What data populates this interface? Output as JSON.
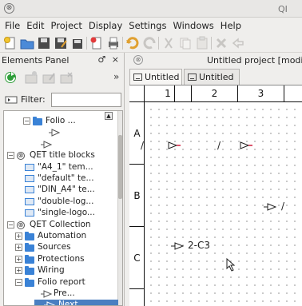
{
  "window": {
    "title": "QI"
  },
  "menu": [
    "File",
    "Edit",
    "Project",
    "Display",
    "Settings",
    "Windows",
    "Help"
  ],
  "elements_panel": {
    "title": "Elements Panel",
    "title_buttons": "♂ ×",
    "filter_label": "Filter:",
    "filter_value": "",
    "tree": [
      {
        "label": "Folio ...",
        "indent": 2,
        "type": "folder",
        "expander": "−"
      },
      {
        "label": "",
        "indent": 4,
        "type": "symbol"
      },
      {
        "label": "",
        "indent": 3,
        "type": "symbol"
      },
      {
        "label": "QET title blocks",
        "indent": 0,
        "type": "qet",
        "expander": "−"
      },
      {
        "label": "\"A4_1\" tem...",
        "indent": 1,
        "type": "tblock"
      },
      {
        "label": "\"default\" te...",
        "indent": 1,
        "type": "tblock"
      },
      {
        "label": "\"DIN_A4\" te...",
        "indent": 1,
        "type": "tblock"
      },
      {
        "label": "\"double-log...",
        "indent": 1,
        "type": "tblock"
      },
      {
        "label": "\"single-logo...",
        "indent": 1,
        "type": "tblock"
      },
      {
        "label": "QET Collection",
        "indent": 0,
        "type": "qet",
        "expander": "−"
      },
      {
        "label": "Automation",
        "indent": 1,
        "type": "folder",
        "expander": "+"
      },
      {
        "label": "Sources",
        "indent": 1,
        "type": "folder",
        "expander": "+"
      },
      {
        "label": "Protections",
        "indent": 1,
        "type": "folder",
        "expander": "+"
      },
      {
        "label": "Wiring",
        "indent": 1,
        "type": "folder",
        "expander": "+"
      },
      {
        "label": "Folio report",
        "indent": 1,
        "type": "folder",
        "expander": "−"
      },
      {
        "label": "Pre...",
        "indent": 3,
        "type": "symbol"
      },
      {
        "label": "Next...",
        "indent": 3,
        "type": "symbol",
        "selected": true
      }
    ]
  },
  "main": {
    "title": "Untitled project [modifi",
    "tabs": [
      "Untitled",
      "Untitled"
    ],
    "columns": [
      "1",
      "2",
      "3"
    ],
    "rows": [
      "A",
      "B",
      "C"
    ],
    "canvas_labels": {
      "slash_a1": "/",
      "slash_a2": "/",
      "slash_b": "/",
      "ref_c": "2-C3"
    }
  },
  "colors": {
    "accent": "#3a82d6",
    "selected_row": "#4a7fc1",
    "red_arrow": "#d01c3a"
  }
}
